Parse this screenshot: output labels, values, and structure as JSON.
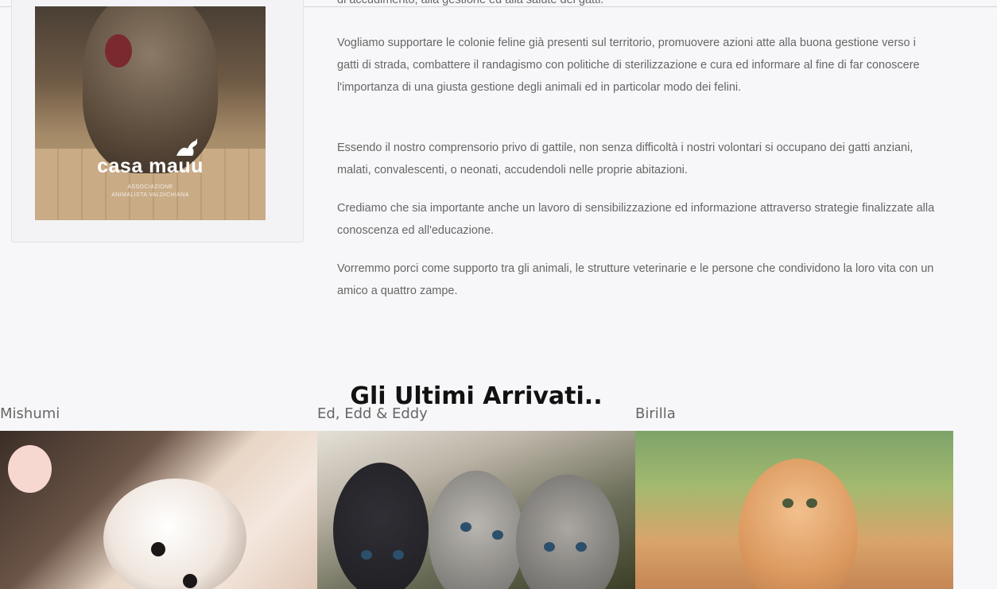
{
  "brand": {
    "name": "casa mauu",
    "subtitle_line1": "ASSOCIAZIONE",
    "subtitle_line2": "ANIMALISTA VALDICHIANA"
  },
  "intro": {
    "cut_line": "di accudimento, alla gestione ed alla salute dei gatti.",
    "paragraphs": [
      "Vogliamo supportare le colonie feline già presenti sul territorio,  promuovere azioni atte alla buona gestione verso i gatti di strada, combattere il randagismo con politiche di sterilizzazione e cura ed informare al fine di far conoscere l'importanza di una giusta gestione degli animali ed in particolar modo dei felini.",
      "Essendo il nostro comprensorio privo di gattile, non senza difficoltà i nostri volontari si occupano dei gatti anziani, malati, convalescenti, o neonati, accudendoli nelle proprie abitazioni.",
      "Crediamo che sia importante anche un lavoro di sensibilizzazione ed informazione attraverso strategie finalizzate alla conoscenza ed all'educazione.",
      "Vorremmo porci come supporto tra gli animali, le strutture veterinarie e le persone che condividono la loro vita con un amico a quattro zampe."
    ]
  },
  "latest": {
    "title": "Gli Ultimi Arrivati..",
    "items": [
      {
        "name": "Mishumi"
      },
      {
        "name": "Ed, Edd & Eddy"
      },
      {
        "name": "Birilla"
      }
    ]
  }
}
